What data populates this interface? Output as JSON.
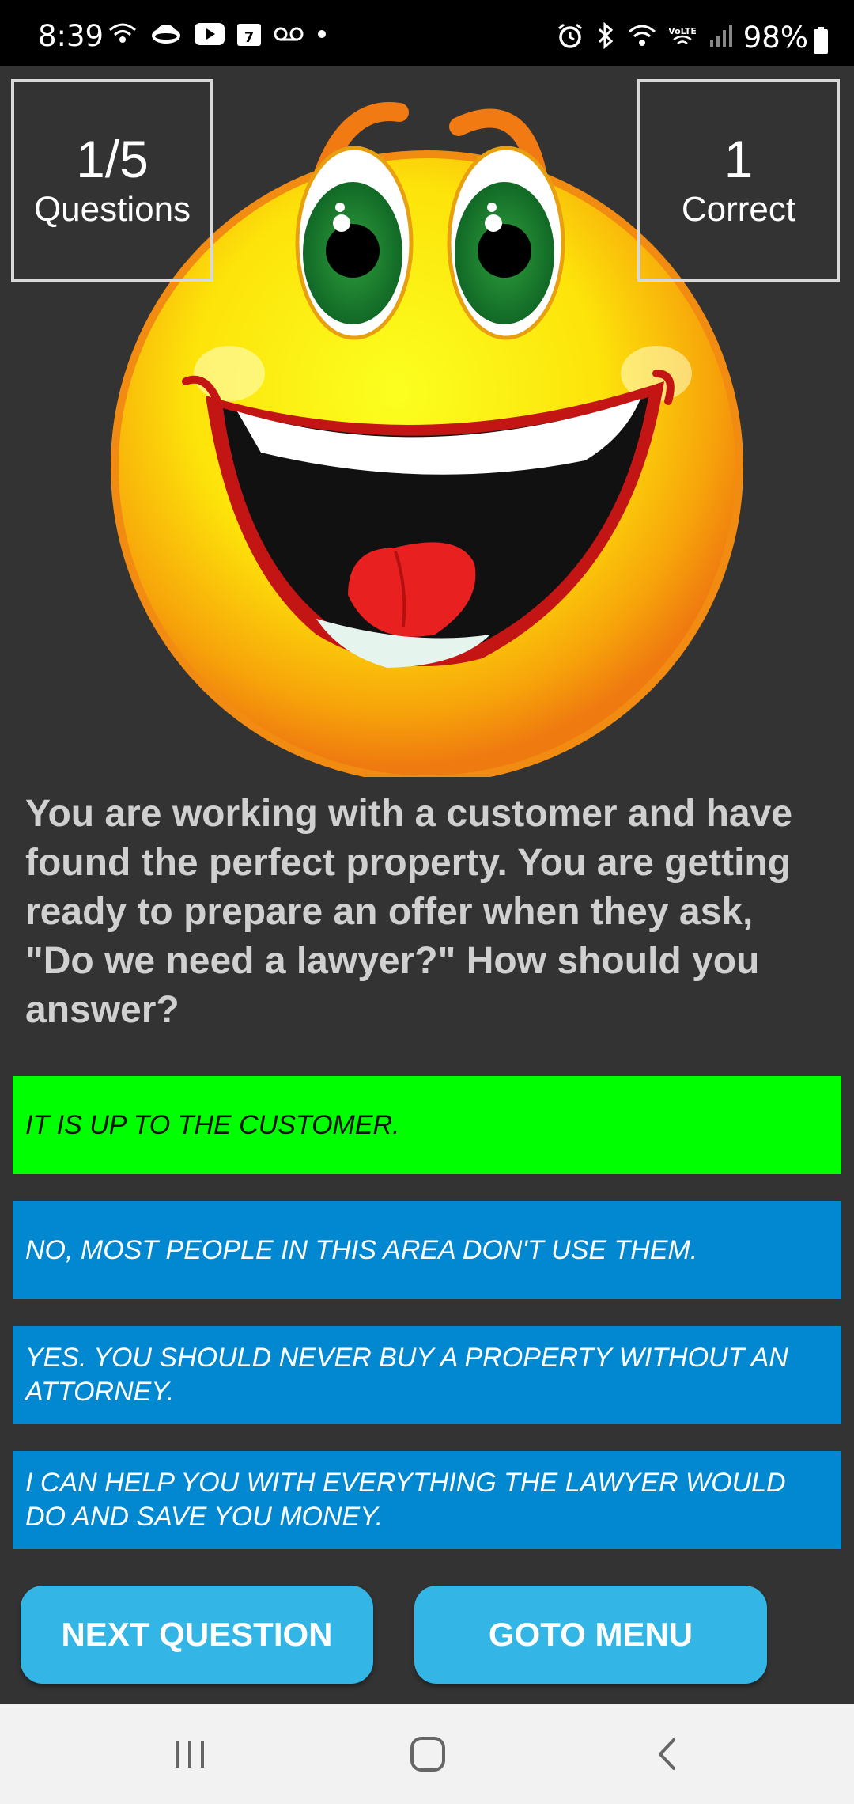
{
  "status_bar": {
    "time": "8:39",
    "battery": "98%",
    "left_icons": [
      "wifi-calling-icon",
      "cloud-icon",
      "youtube-icon",
      "calendar-icon",
      "voicemail-icon",
      "dot-icon"
    ],
    "calendar_day": "7",
    "right_icons": [
      "alarm-icon",
      "bluetooth-icon",
      "wifi-icon",
      "volte-icon",
      "signal-icon"
    ],
    "volte_label": "VoLTE"
  },
  "score": {
    "questions_value": "1/5",
    "questions_label": "Questions",
    "correct_value": "1",
    "correct_label": "Correct"
  },
  "question": {
    "text": "You are working with a customer and have found the perfect property. You are getting ready to prepare an offer when they ask, \"Do we need a lawyer?\" How should you answer?"
  },
  "answers": [
    {
      "text": "IT IS UP TO THE CUSTOMER.",
      "state": "correct"
    },
    {
      "text": "NO, MOST PEOPLE IN THIS AREA DON'T USE THEM.",
      "state": "default"
    },
    {
      "text": "YES. YOU SHOULD NEVER BUY A PROPERTY WITHOUT AN ATTORNEY.",
      "state": "default"
    },
    {
      "text": "I CAN HELP YOU WITH EVERYTHING THE LAWYER WOULD DO AND SAVE YOU MONEY.",
      "state": "default"
    }
  ],
  "buttons": {
    "next": "NEXT QUESTION",
    "menu": "GOTO MENU"
  },
  "nav": [
    "recent-apps-icon",
    "home-icon",
    "back-icon"
  ],
  "colors": {
    "background": "#333333",
    "correct": "#00ff00",
    "answer": "#0288d1",
    "button": "#33b5e5"
  }
}
